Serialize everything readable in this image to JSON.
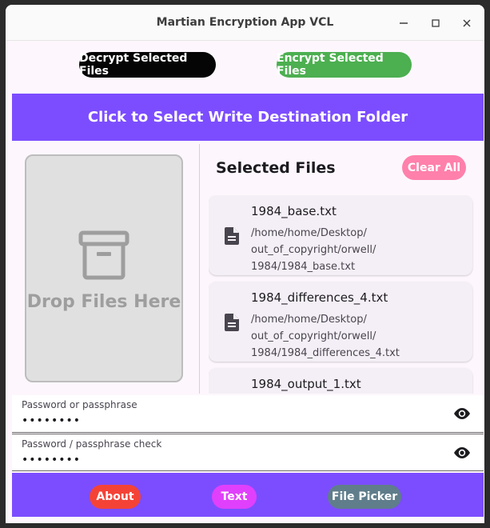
{
  "window": {
    "title": "Martian Encryption App VCL",
    "controls": [
      "minimize-icon",
      "maximize-icon",
      "close-icon"
    ]
  },
  "actions": {
    "decrypt_label": "Decrypt Selected Files",
    "encrypt_label": "Encrypt Selected Files",
    "destination_label": "Click to Select Write Destination Folder"
  },
  "dropzone": {
    "icon": "archive-box-icon",
    "label": "Drop Files Here"
  },
  "files": {
    "heading": "Selected Files",
    "clear_label": "Clear All",
    "items": [
      {
        "name": "1984_base.txt",
        "path": "/home/home/Desktop/\nout_of_copyright/orwell/\n1984/1984_base.txt"
      },
      {
        "name": "1984_differences_4.txt",
        "path": "/home/home/Desktop/\nout_of_copyright/orwell/\n1984/1984_differences_4.txt"
      },
      {
        "name": "1984_output_1.txt",
        "path": ""
      }
    ]
  },
  "password": {
    "label": "Password or passphrase",
    "value": "••••••••"
  },
  "password_check": {
    "label": "Password / passphrase check",
    "value": "••••••••"
  },
  "bottom": {
    "about_label": "About",
    "text_label": "Text",
    "picker_label": "File Picker"
  },
  "colors": {
    "accent": "#7c4dff",
    "encrypt": "#4caf50",
    "decrypt": "#050505",
    "clear": "#ff80ab",
    "about": "#f44336",
    "text": "#e040fb",
    "picker": "#607d8b"
  }
}
